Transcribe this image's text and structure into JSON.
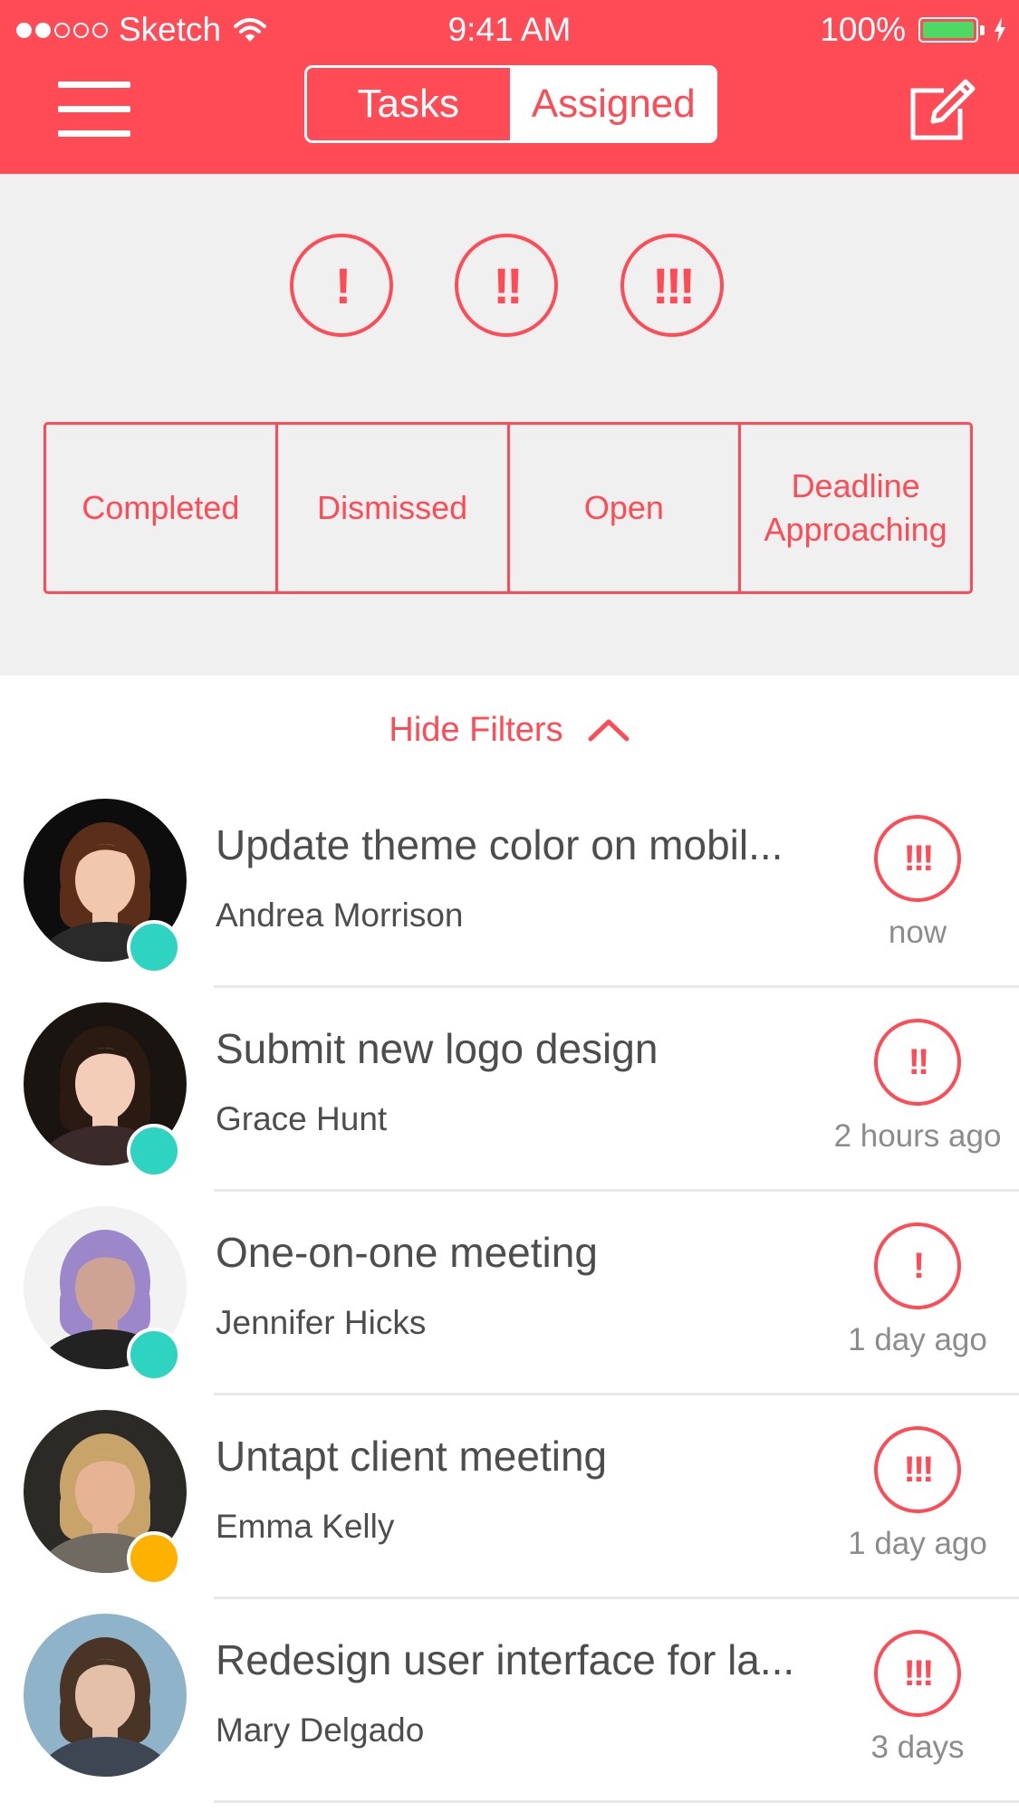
{
  "status_bar": {
    "signal": {
      "filled": 2,
      "total": 5
    },
    "carrier": "Sketch",
    "time": "9:41 AM",
    "battery_percent": "100%",
    "battery_level": 1.0,
    "battery_color": "#4cd964"
  },
  "header": {
    "background": "#ff4b55",
    "menu_icon": "hamburger-menu-icon",
    "tabs": [
      {
        "label": "Tasks",
        "selected": false
      },
      {
        "label": "Assigned",
        "selected": true
      }
    ],
    "compose_icon": "compose-icon"
  },
  "filters": {
    "priorities": [
      {
        "label": "!",
        "level": 1
      },
      {
        "label": "!!",
        "level": 2
      },
      {
        "label": "!!!",
        "level": 3
      }
    ],
    "statuses": [
      "Completed",
      "Dismissed",
      "Open",
      "Deadline Approaching"
    ],
    "hide_label": "Hide Filters",
    "hide_icon": "chevron-up-icon"
  },
  "tasks": [
    {
      "title": "Update theme color on mobil...",
      "assignee": "Andrea Morrison",
      "priority": "!!!",
      "time": "now",
      "presence_color": "#2ed3c2",
      "avatar": {
        "bg": "#0d0d0d",
        "hair": "#5a2e18",
        "skin": "#f1c7ad",
        "shirt": "#2a2a2a"
      }
    },
    {
      "title": "Submit new logo design",
      "assignee": "Grace Hunt",
      "priority": "!!",
      "time": "2 hours ago",
      "presence_color": "#2ed3c2",
      "avatar": {
        "bg": "#1a1410",
        "hair": "#2b1a12",
        "skin": "#f3cdb8",
        "shirt": "#3a2a2a"
      }
    },
    {
      "title": "One-on-one meeting",
      "assignee": "Jennifer Hicks",
      "priority": "!",
      "time": "1 day ago",
      "presence_color": "#2ed3c2",
      "avatar": {
        "bg": "#f2f2f2",
        "hair": "#9b87c9",
        "skin": "#cfa394",
        "shirt": "#222222"
      }
    },
    {
      "title": "Untapt client meeting",
      "assignee": "Emma Kelly",
      "priority": "!!!",
      "time": "1 day ago",
      "presence_color": "#ffb100",
      "avatar": {
        "bg": "#2b2a26",
        "hair": "#c9a46a",
        "skin": "#e6b494",
        "shirt": "#6f6a62"
      }
    },
    {
      "title": "Redesign user interface for la...",
      "assignee": "Mary Delgado",
      "priority": "!!!",
      "time": "3 days",
      "presence_color": null,
      "avatar": {
        "bg": "#8fb3c8",
        "hair": "#4a3426",
        "skin": "#e4c0a8",
        "shirt": "#3d4652"
      }
    }
  ]
}
